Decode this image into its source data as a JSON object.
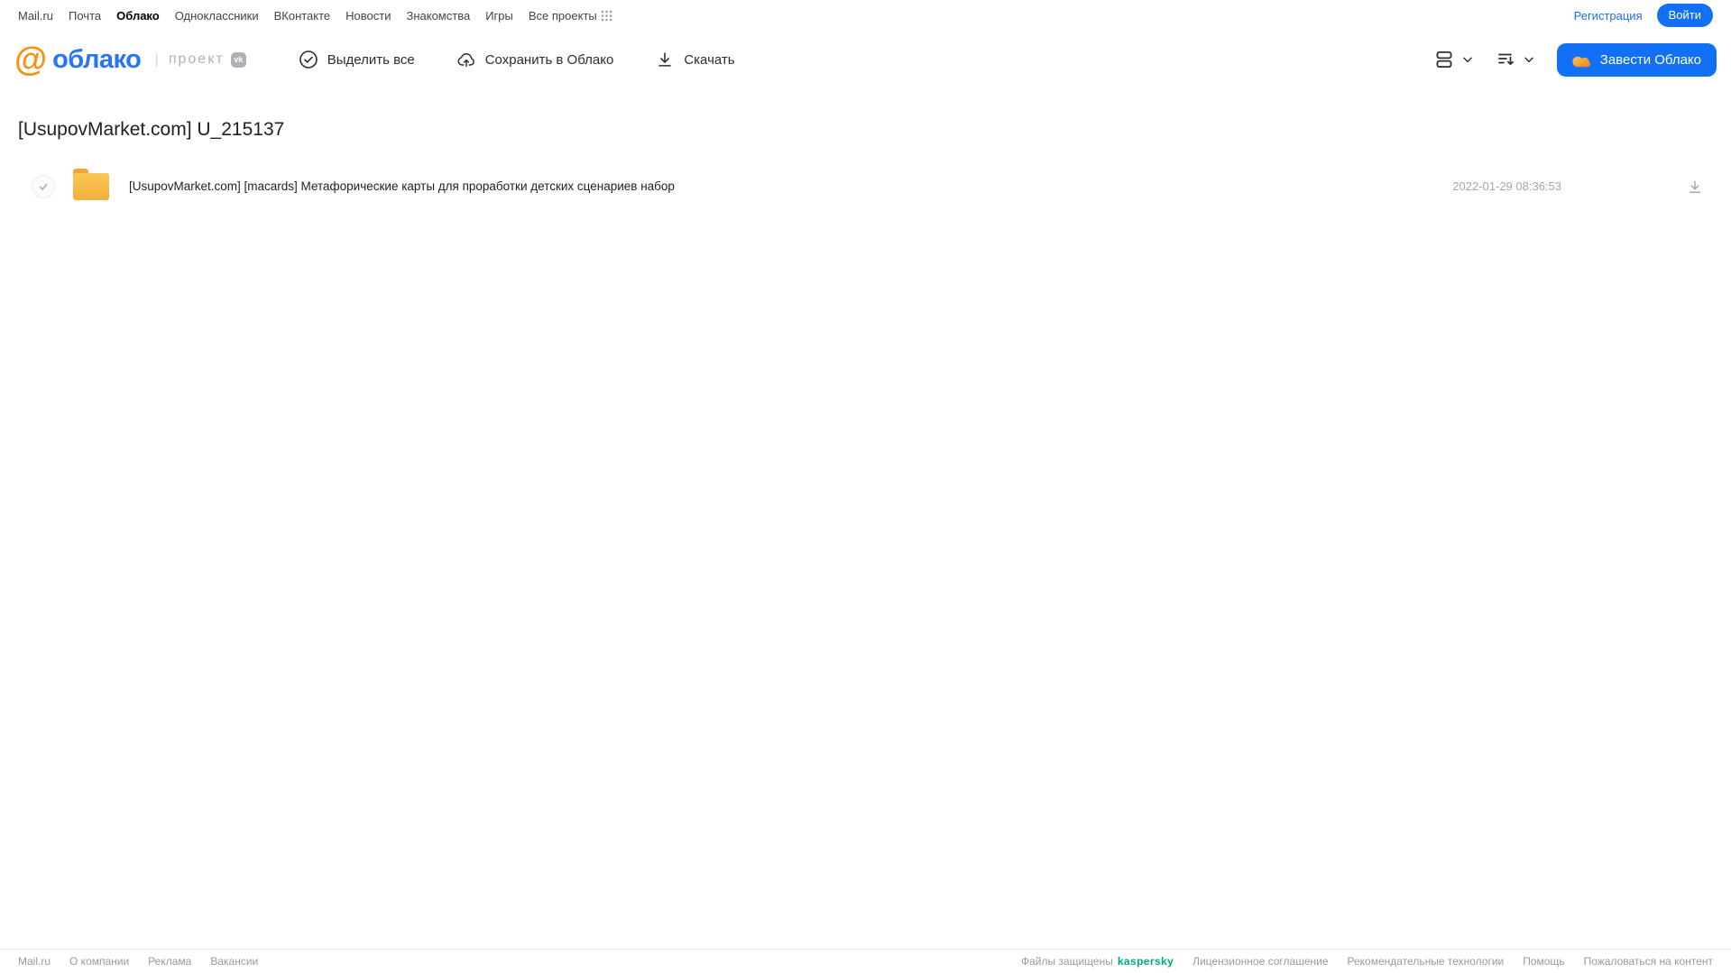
{
  "portal_nav": {
    "items": [
      {
        "label": "Mail.ru",
        "active": false
      },
      {
        "label": "Почта",
        "active": false
      },
      {
        "label": "Облако",
        "active": true
      },
      {
        "label": "Одноклассники",
        "active": false
      },
      {
        "label": "ВКонтакте",
        "active": false
      },
      {
        "label": "Новости",
        "active": false
      },
      {
        "label": "Знакомства",
        "active": false
      },
      {
        "label": "Игры",
        "active": false
      },
      {
        "label": "Все проекты",
        "active": false
      }
    ],
    "apps_grid_icon": "apps-grid-icon",
    "registration_label": "Регистрация",
    "login_label": "Войти"
  },
  "header": {
    "logo_at": "@",
    "logo_text": "облако",
    "logo_divider": "|",
    "project_label": "проект",
    "vk_badge": "vk",
    "actions": [
      {
        "label": "Выделить все",
        "icon": "check-circle-icon"
      },
      {
        "label": "Сохранить в Облако",
        "icon": "cloud-upload-icon"
      },
      {
        "label": "Скачать",
        "icon": "download-icon"
      }
    ],
    "view_controls": [
      {
        "icon": "list-view-icon",
        "chevron": "chevron-down-icon"
      },
      {
        "icon": "sort-icon",
        "chevron": "chevron-down-icon"
      }
    ],
    "get_cloud_button": {
      "label": "Завести Облако",
      "icon": "cloud-icon"
    }
  },
  "main": {
    "title": "[UsupovMarket.com] U_215137",
    "files": [
      {
        "type": "folder",
        "name": "[UsupovMarket.com] [macards] Метафорические карты для проработки детских сценариев набор",
        "date": "2022-01-29 08:36:53",
        "checked": true
      }
    ]
  },
  "footer": {
    "left_links": [
      "Mail.ru",
      "О компании",
      "Реклама",
      "Вакансии"
    ],
    "kaspersky_prefix": "Файлы защищены",
    "kaspersky_logo": "kaspersky",
    "right_links": [
      "Лицензионное соглашение",
      "Рекомендательные технологии",
      "Помощь",
      "Пожаловаться на контент"
    ]
  },
  "colors": {
    "primary_blue": "#1170F5",
    "logo_blue": "#2775F2",
    "logo_orange": "#F89113",
    "folder_light": "#F9C851",
    "folder_dark": "#F4AE41",
    "kaspersky_green": "#00A88E",
    "toolbar_text": "#2C2D2E",
    "muted_gray": "#A6A6A6"
  }
}
